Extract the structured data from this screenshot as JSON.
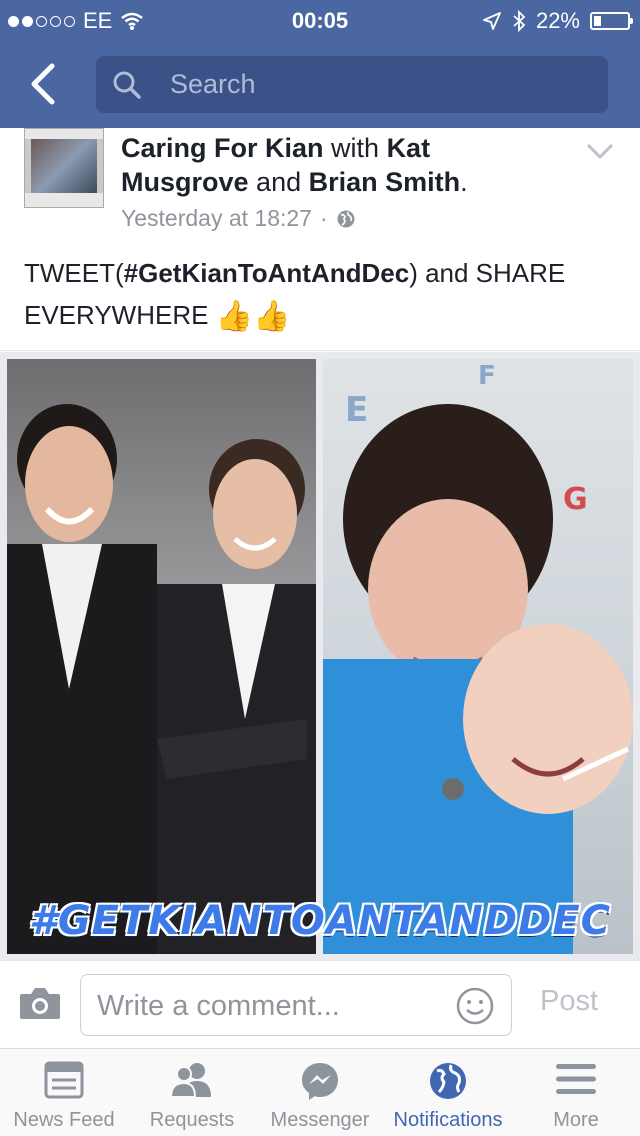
{
  "status_bar": {
    "carrier": "EE",
    "time": "00:05",
    "battery": "22%",
    "signal_bars_filled": 2,
    "signal_bars_total": 5
  },
  "nav": {
    "search_placeholder": "Search"
  },
  "post": {
    "author_page": "Caring For Kian",
    "with_text": "with",
    "tagged_1": "Kat Musgrove",
    "and_text": "and",
    "tagged_2": "Brian Smith",
    "period": ".",
    "timestamp": "Yesterday at 18:27",
    "separator": "·",
    "text_prefix": "TWEET(",
    "hashtag": "#GetKianToAntAndDec",
    "text_suffix": ") and SHARE EVERYWHERE",
    "emoji": "👍👍",
    "photo_banner": "#GETKIANTOANTANDDEC"
  },
  "comment": {
    "placeholder": "Write a comment...",
    "post_label": "Post"
  },
  "tabs": [
    {
      "label": "News Feed",
      "icon": "news-feed-icon"
    },
    {
      "label": "Requests",
      "icon": "requests-icon"
    },
    {
      "label": "Messenger",
      "icon": "messenger-icon"
    },
    {
      "label": "Notifications",
      "icon": "globe-icon"
    },
    {
      "label": "More",
      "icon": "menu-icon"
    }
  ],
  "active_tab": "Notifications",
  "colors": {
    "brand": "#4b67a1",
    "active_tab": "#4267b2",
    "banner_text": "#3c7be8"
  }
}
